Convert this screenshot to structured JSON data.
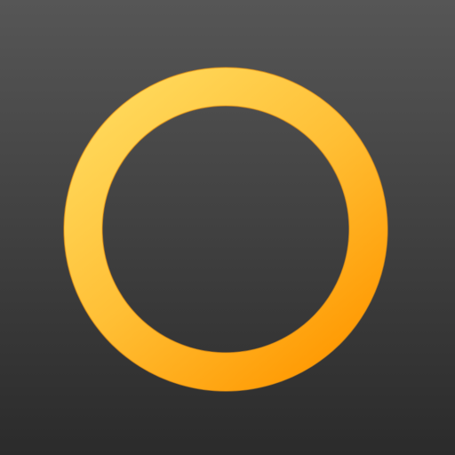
{
  "app_icon": {
    "name": "ring-icon",
    "colors": {
      "background_top": "#565656",
      "background_bottom": "#2b2b2b",
      "ring_light": "#ffd85a",
      "ring_mid": "#ffbf35",
      "ring_dark": "#ff9800",
      "ring_stroke": "#f49a12"
    }
  }
}
